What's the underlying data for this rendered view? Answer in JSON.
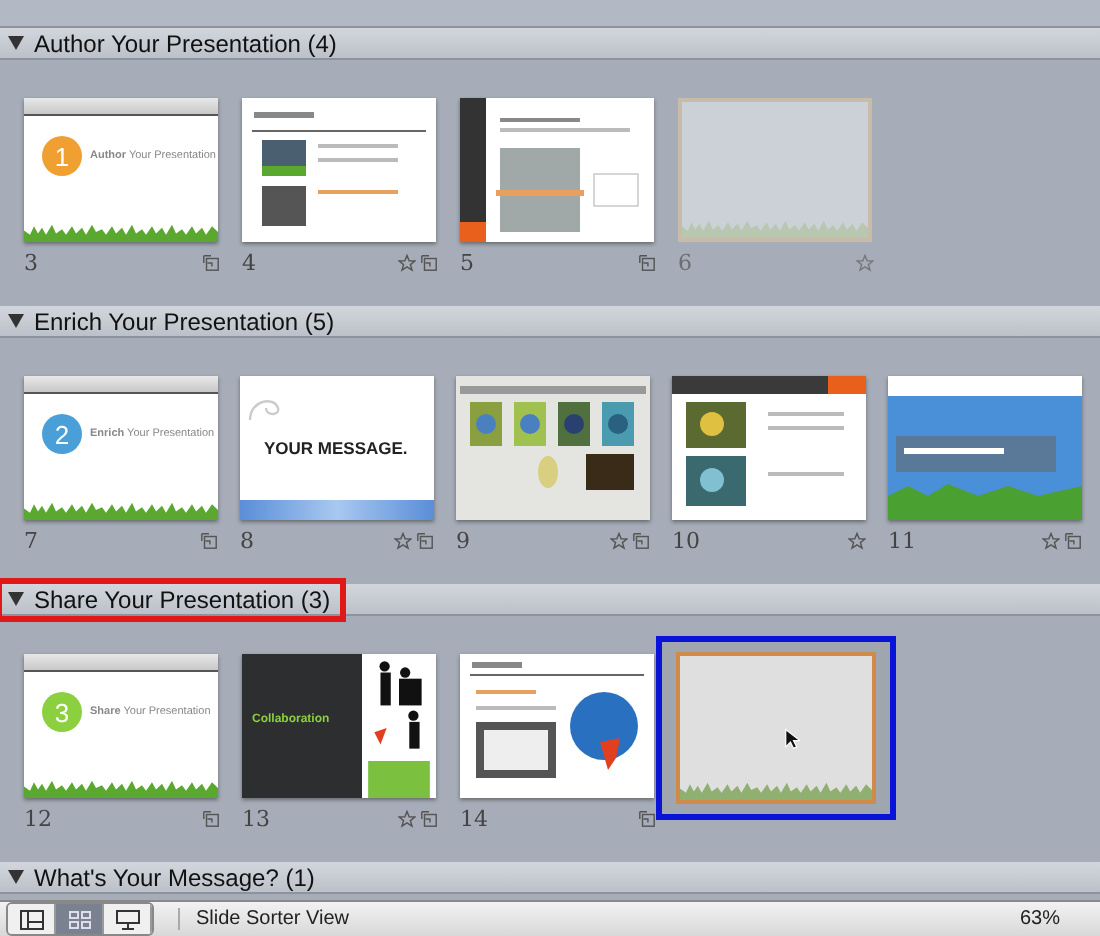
{
  "sections": [
    {
      "title": "Author Your Presentation (4)",
      "expanded": true,
      "highlighted": false,
      "slides": [
        {
          "number": "3",
          "kind": "title",
          "title": "**Author** Your Presentation",
          "circle": "1",
          "color": "#f0a030",
          "star": false,
          "transition": true
        },
        {
          "number": "4",
          "kind": "layout",
          "star": true,
          "transition": true
        },
        {
          "number": "5",
          "kind": "sidebar",
          "star": false,
          "transition": true
        },
        {
          "number": "6",
          "kind": "ghost",
          "star": true,
          "transition": false
        }
      ]
    },
    {
      "title": "Enrich Your Presentation (5)",
      "expanded": true,
      "highlighted": false,
      "slides": [
        {
          "number": "7",
          "kind": "title",
          "title": "**Enrich** Your Presentation",
          "circle": "2",
          "color": "#4a9fd8",
          "star": false,
          "transition": true
        },
        {
          "number": "8",
          "kind": "message",
          "title": "YOUR MESSAGE.",
          "star": true,
          "transition": true
        },
        {
          "number": "9",
          "kind": "photos",
          "star": true,
          "transition": true
        },
        {
          "number": "10",
          "kind": "flowers",
          "star": true,
          "transition": false
        },
        {
          "number": "11",
          "kind": "blue",
          "star": true,
          "transition": true
        }
      ]
    },
    {
      "title": "Share Your Presentation (3)",
      "expanded": true,
      "highlighted": true,
      "slides": [
        {
          "number": "12",
          "kind": "title",
          "title": "**Share** Your Presentation",
          "circle": "3",
          "color": "#8cd040",
          "star": false,
          "transition": true
        },
        {
          "number": "13",
          "kind": "dark",
          "title": "Collaboration",
          "star": true,
          "transition": true
        },
        {
          "number": "14",
          "kind": "globe",
          "star": false,
          "transition": true
        },
        {
          "kind": "drop"
        }
      ]
    },
    {
      "title": "What's Your Message? (1)",
      "expanded": true,
      "highlighted": false
    }
  ],
  "status_bar": {
    "views": [
      {
        "kind": "normal",
        "selected": false
      },
      {
        "kind": "sorter",
        "selected": true
      },
      {
        "kind": "show",
        "selected": false
      }
    ],
    "label": "Slide Sorter View",
    "zoom": "63%"
  }
}
